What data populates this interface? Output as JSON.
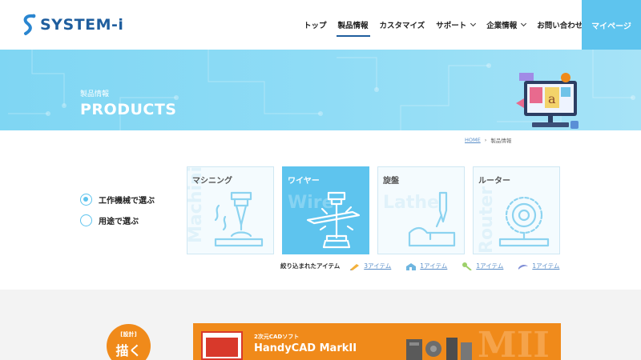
{
  "brand": {
    "name": "SYSTEM-i"
  },
  "nav": {
    "items": [
      {
        "label": "トップ",
        "dropdown": false,
        "active": false
      },
      {
        "label": "製品情報",
        "dropdown": false,
        "active": true
      },
      {
        "label": "カスタマイズ",
        "dropdown": false,
        "active": false
      },
      {
        "label": "サポート",
        "dropdown": true,
        "active": false
      },
      {
        "label": "企業情報",
        "dropdown": true,
        "active": false
      },
      {
        "label": "お問い合わせ",
        "dropdown": true,
        "active": false
      }
    ],
    "mypage_label": "マイページ"
  },
  "hero": {
    "subtitle": "製品情報",
    "title": "PRODUCTS"
  },
  "breadcrumb": {
    "home": "HOME",
    "separator": "›",
    "current": "製品情報"
  },
  "selector": {
    "options": [
      {
        "label": "工作機械で選ぶ",
        "checked": true
      },
      {
        "label": "用途で選ぶ",
        "checked": false
      }
    ]
  },
  "categories": [
    {
      "label": "マシニング",
      "watermark": "Machining",
      "active": false,
      "icon": "machining-icon"
    },
    {
      "label": "ワイヤー",
      "watermark": "Wire",
      "active": true,
      "icon": "wire-icon"
    },
    {
      "label": "旋盤",
      "watermark": "Lathe",
      "active": false,
      "icon": "lathe-icon"
    },
    {
      "label": "ルーター",
      "watermark": "Router",
      "active": false,
      "icon": "router-icon"
    }
  ],
  "filter": {
    "label": "絞り込まれたアイテム",
    "items": [
      {
        "count": "3アイテム",
        "icon": "pen-icon"
      },
      {
        "count": "1アイテム",
        "icon": "house-icon"
      },
      {
        "count": "1アイテム",
        "icon": "wrench-icon"
      },
      {
        "count": "1アイテム",
        "icon": "swoosh-icon"
      }
    ]
  },
  "promo": {
    "badge_small": "[設計]",
    "badge_big": "描く",
    "banner_sub": "2次元CADソフト",
    "banner_title": "HandyCAD MarkII",
    "banner_watermark": "MII"
  },
  "colors": {
    "accent": "#5ec4ee",
    "brand": "#1f5e9e",
    "promo": "#f08a1a",
    "link": "#5b8fc9"
  }
}
